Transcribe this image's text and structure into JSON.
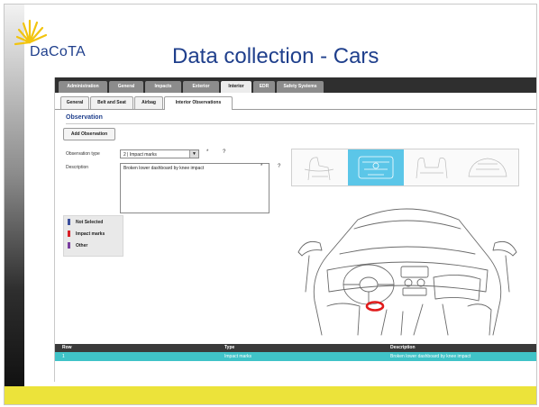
{
  "slide": {
    "logo_text": "DaCoTA",
    "title": "Data collection - Cars"
  },
  "top_tabs": [
    "Administration",
    "General",
    "Impacts",
    "Exterior",
    "Interior",
    "EDR",
    "Safety Systems"
  ],
  "active_top_tab": "Interior",
  "sub_tabs": [
    "General",
    "Belt and Seat",
    "Airbag",
    "Interior Observations"
  ],
  "active_sub_tab": "Interior Observations",
  "observation": {
    "section_title": "Observation",
    "add_button": "Add Observation",
    "type_label": "Observation type",
    "type_value": "2 | Impact marks",
    "type_arrow": "▼",
    "description_label": "Description",
    "description_value": "Broken lower dashboard by knee impact",
    "required_mark": "*",
    "help_mark": "?"
  },
  "legend": [
    {
      "label": "Not Selected",
      "color": "#3b4f9c"
    },
    {
      "label": "Impact marks",
      "color": "#d81f26"
    },
    {
      "label": "Other",
      "color": "#7a3ea0"
    }
  ],
  "table": {
    "headers": [
      "Row",
      "Type",
      "Description"
    ],
    "rows": [
      {
        "row": "1",
        "type": "Impact marks",
        "description": "Broken lower dashboard by knee impact"
      }
    ]
  },
  "colors": {
    "accent": "#1f3f8c",
    "selected_row": "#40c3c8",
    "bottom_band": "#ece33a",
    "thumb_selected": "#5bc6e8"
  }
}
